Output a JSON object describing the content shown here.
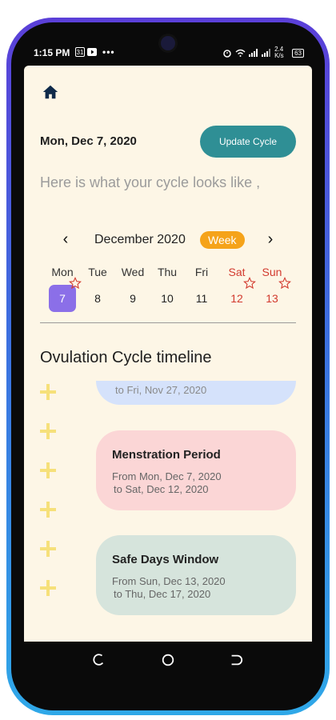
{
  "status_bar": {
    "time": "1:15 PM",
    "calendar_badge": "31",
    "net_speed": "2.4 K/s",
    "battery": "63"
  },
  "header": {
    "date": "Mon, Dec 7, 2020",
    "update_button": "Update Cycle",
    "subtitle": "Here is what your cycle looks like ,"
  },
  "calendar": {
    "month": "December 2020",
    "view": "Week",
    "days": [
      {
        "name": "Mon",
        "date": "7"
      },
      {
        "name": "Tue",
        "date": "8"
      },
      {
        "name": "Wed",
        "date": "9"
      },
      {
        "name": "Thu",
        "date": "10"
      },
      {
        "name": "Fri",
        "date": "11"
      },
      {
        "name": "Sat",
        "date": "12"
      },
      {
        "name": "Sun",
        "date": "13"
      }
    ],
    "selected_day": "7",
    "weekend_color": "#d23a2e",
    "selected_color": "#8b6fe8"
  },
  "timeline": {
    "title": "Ovulation Cycle timeline",
    "partial_card_text": "to Fri, Nov 27, 2020",
    "cards": [
      {
        "title": "Menstration Period",
        "from": "From Mon, Dec 7, 2020",
        "to": "to Sat, Dec 12, 2020"
      },
      {
        "title": "Safe Days Window",
        "from": "From Sun, Dec 13, 2020",
        "to": "to Thu, Dec 17, 2020"
      }
    ]
  },
  "colors": {
    "accent": "#2f8f95",
    "week_pill": "#f5a31a",
    "background": "#fdf6e6"
  }
}
